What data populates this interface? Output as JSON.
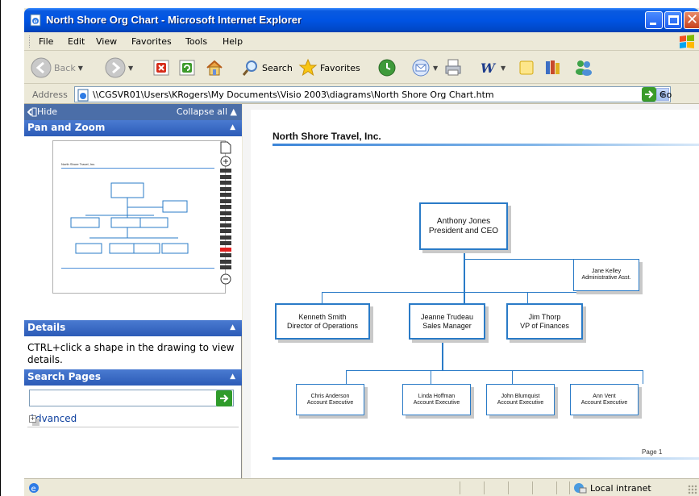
{
  "window": {
    "title": "North Shore Org Chart - Microsoft Internet Explorer"
  },
  "menu": [
    "File",
    "Edit",
    "View",
    "Favorites",
    "Tools",
    "Help"
  ],
  "toolbar": {
    "back_label": "Back",
    "search_label": "Search",
    "favorites_label": "Favorites"
  },
  "address": {
    "label": "Address",
    "url": "\\\\CGSVR01\\Users\\KRogers\\My Documents\\Visio 2003\\diagrams\\North Shore Org Chart.htm",
    "go_label": "Go"
  },
  "left_pane": {
    "hide_label": "Hide",
    "collapse_label": "Collapse all",
    "pan_zoom_title": "Pan and Zoom",
    "details_title": "Details",
    "details_text": "CTRL+click a shape in the drawing to view details.",
    "search_title": "Search Pages",
    "search_value": "",
    "advanced_label": "Advanced",
    "zoom_level_index": 13,
    "zoom_levels": 17
  },
  "org_chart": {
    "page_title": "North Shore Travel, Inc.",
    "page_number": "Page 1",
    "president": {
      "name": "Anthony Jones",
      "role": "President and CEO"
    },
    "assistant": {
      "name": "Jane Kelley",
      "role": "Administrative Asst."
    },
    "managers": [
      {
        "name": "Kenneth Smith",
        "role": "Director of Operations"
      },
      {
        "name": "Jeanne Trudeau",
        "role": "Sales Manager"
      },
      {
        "name": "Jim Thorp",
        "role": "VP of Finances"
      }
    ],
    "executives": [
      {
        "name": "Chris Anderson",
        "role": "Account Executive"
      },
      {
        "name": "Linda Hoffman",
        "role": "Account Executive"
      },
      {
        "name": "John Blumquist",
        "role": "Account Executive"
      },
      {
        "name": "Ann Vent",
        "role": "Account Executive"
      }
    ]
  },
  "status": {
    "zone": "Local intranet"
  },
  "colors": {
    "titlebar": "#0054e3",
    "pane_header": "#2c5bb7",
    "org_border": "#2a7bc7",
    "zoom_selected": "#e02020"
  }
}
